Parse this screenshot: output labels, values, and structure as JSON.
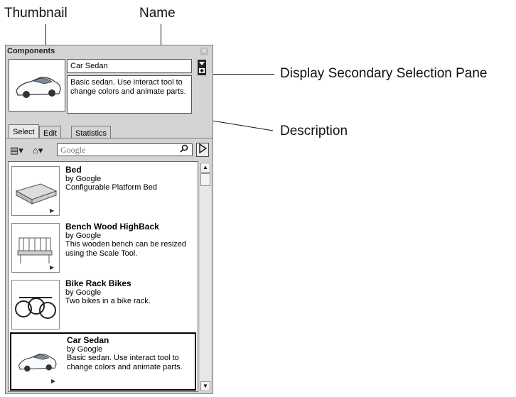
{
  "callouts": {
    "thumbnail": "Thumbnail",
    "name": "Name",
    "secondary_pane": "Display Secondary Selection Pane",
    "description": "Description"
  },
  "panel": {
    "title": "Components",
    "close_glyph": "✕",
    "name_value": "Car Sedan",
    "description_value": "Basic sedan.  Use interact tool to change colors and animate parts.",
    "tabs": [
      {
        "label": "Select"
      },
      {
        "label": "Edit"
      },
      {
        "label": "Statistics"
      }
    ],
    "search_placeholder": "Google",
    "search_icon": "magnifier-icon",
    "items": [
      {
        "name": "Bed",
        "author": "by Google",
        "description": "Configurable Platform Bed",
        "icon": "bed-thumbnail"
      },
      {
        "name": "Bench Wood HighBack",
        "author": "by Google",
        "description": "This wooden bench can be resized using the Scale Tool.",
        "icon": "bench-thumbnail"
      },
      {
        "name": "Bike Rack Bikes",
        "author": "by Google",
        "description": "Two bikes in a bike rack.",
        "icon": "bikes-thumbnail"
      },
      {
        "name": "Car Sedan",
        "author": "by Google",
        "description": "Basic sedan.  Use interact tool to change colors and animate parts.",
        "icon": "car-thumbnail"
      }
    ]
  }
}
